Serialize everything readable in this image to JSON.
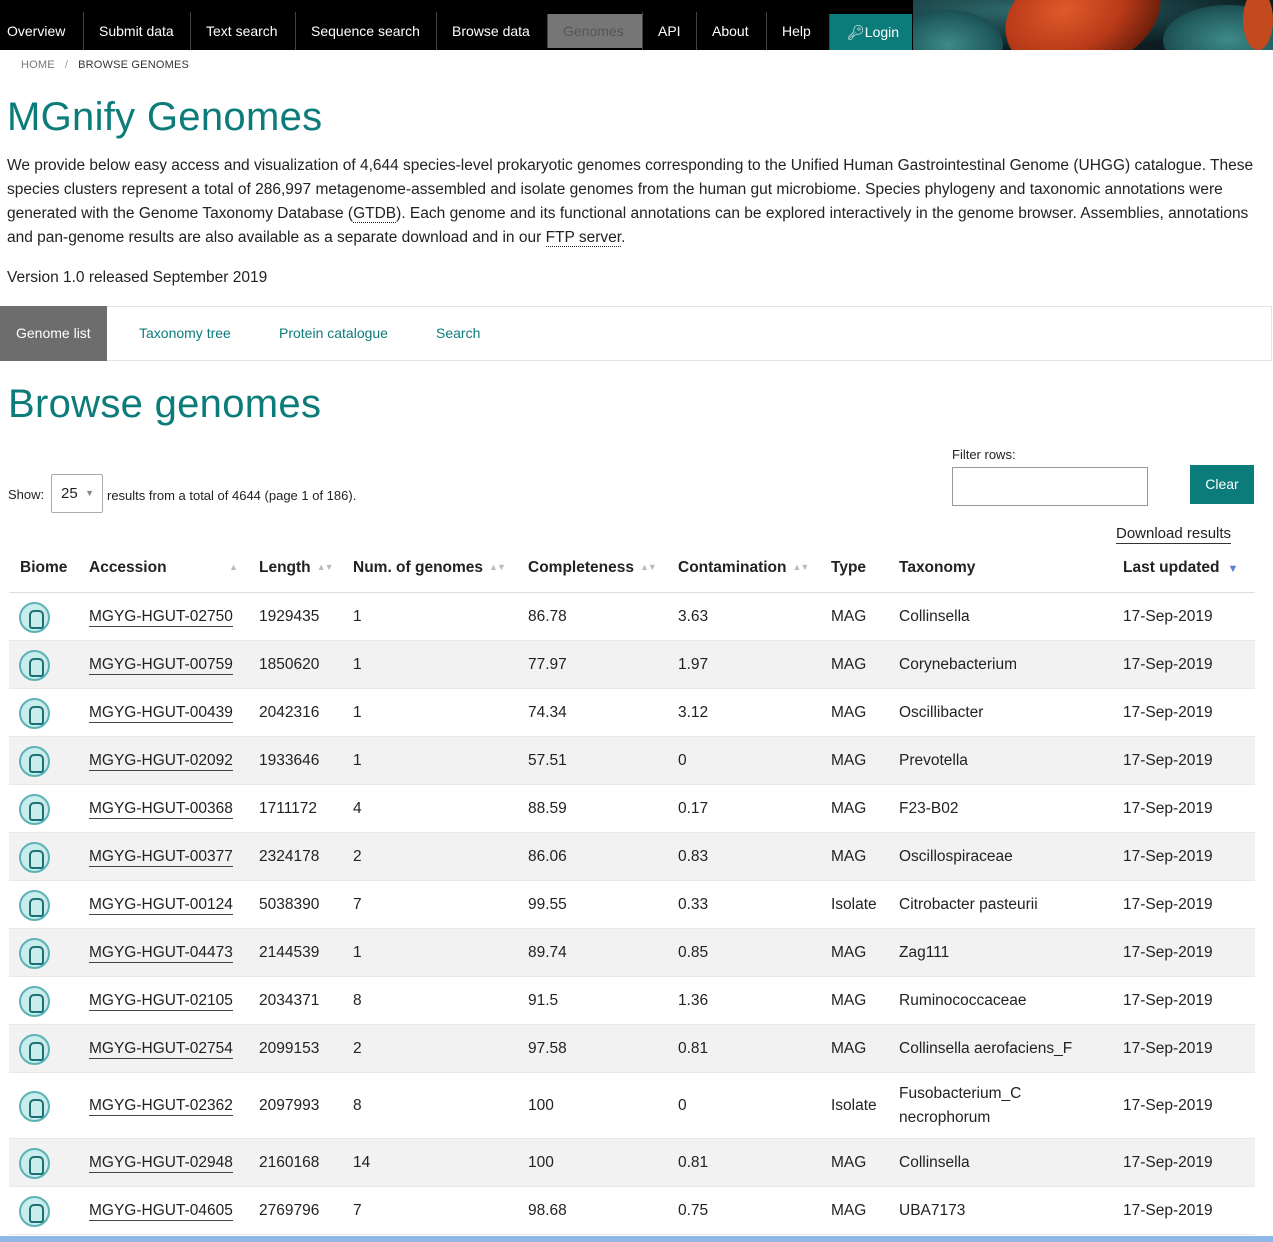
{
  "nav": {
    "items": [
      "Overview",
      "Submit data",
      "Text search",
      "Sequence search",
      "Browse data",
      "Genomes",
      "API",
      "About",
      "Help"
    ],
    "active": "Genomes",
    "login_label": "Login",
    "login_icon": "key-icon",
    "colors": {
      "bar": "#000000",
      "active_tab": "#767676",
      "login": "#0b7c79"
    }
  },
  "breadcrumb": {
    "home": "HOME",
    "current": "BROWSE GENOMES"
  },
  "page": {
    "title": "MGnify Genomes",
    "intro_1": "We provide below easy access and visualization of 4,644 species-level prokaryotic genomes corresponding to the Unified Human Gastrointestinal Genome (UHGG) catalogue. These species clusters represent a total of 286,997 metagenome-assembled and isolate genomes from the human gut microbiome. Species phylogeny and taxonomic annotations were generated with the Genome Taxonomy Database (",
    "intro_gtdb": "GTDB",
    "intro_2": "). Each genome and its functional annotations can be explored interactively in the genome browser. Assemblies, annotations and pan-genome results are also available as a separate download and in our ",
    "intro_ftp": "FTP server",
    "intro_3": ".",
    "version": "Version 1.0 released September 2019"
  },
  "tabs": [
    "Genome list",
    "Taxonomy tree",
    "Protein catalogue",
    "Search"
  ],
  "browse": {
    "title": "Browse genomes",
    "show_label": "Show:",
    "page_size": "25",
    "results_text": "results from a total of 4644 (page 1 of 186).",
    "filter_label": "Filter rows:",
    "clear_label": "Clear",
    "download_label": "Download results"
  },
  "table": {
    "columns": [
      "Biome",
      "Accession",
      "Length",
      "Num. of genomes",
      "Completeness",
      "Contamination",
      "Type",
      "Taxonomy",
      "Last updated"
    ],
    "sort_column": "Last updated",
    "biome_icon": "human-gut-biome-icon",
    "rows": [
      {
        "accession": "MGYG-HGUT-02750",
        "length": "1929435",
        "num": "1",
        "completeness": "86.78",
        "contamination": "3.63",
        "type": "MAG",
        "taxonomy": "Collinsella",
        "updated": "17-Sep-2019"
      },
      {
        "accession": "MGYG-HGUT-00759",
        "length": "1850620",
        "num": "1",
        "completeness": "77.97",
        "contamination": "1.97",
        "type": "MAG",
        "taxonomy": "Corynebacterium",
        "updated": "17-Sep-2019"
      },
      {
        "accession": "MGYG-HGUT-00439",
        "length": "2042316",
        "num": "1",
        "completeness": "74.34",
        "contamination": "3.12",
        "type": "MAG",
        "taxonomy": "Oscillibacter",
        "updated": "17-Sep-2019"
      },
      {
        "accession": "MGYG-HGUT-02092",
        "length": "1933646",
        "num": "1",
        "completeness": "57.51",
        "contamination": "0",
        "type": "MAG",
        "taxonomy": "Prevotella",
        "updated": "17-Sep-2019"
      },
      {
        "accession": "MGYG-HGUT-00368",
        "length": "1711172",
        "num": "4",
        "completeness": "88.59",
        "contamination": "0.17",
        "type": "MAG",
        "taxonomy": "F23-B02",
        "updated": "17-Sep-2019"
      },
      {
        "accession": "MGYG-HGUT-00377",
        "length": "2324178",
        "num": "2",
        "completeness": "86.06",
        "contamination": "0.83",
        "type": "MAG",
        "taxonomy": "Oscillospiraceae",
        "updated": "17-Sep-2019"
      },
      {
        "accession": "MGYG-HGUT-00124",
        "length": "5038390",
        "num": "7",
        "completeness": "99.55",
        "contamination": "0.33",
        "type": "Isolate",
        "taxonomy": "Citrobacter pasteurii",
        "updated": "17-Sep-2019"
      },
      {
        "accession": "MGYG-HGUT-04473",
        "length": "2144539",
        "num": "1",
        "completeness": "89.74",
        "contamination": "0.85",
        "type": "MAG",
        "taxonomy": "Zag111",
        "updated": "17-Sep-2019"
      },
      {
        "accession": "MGYG-HGUT-02105",
        "length": "2034371",
        "num": "8",
        "completeness": "91.5",
        "contamination": "1.36",
        "type": "MAG",
        "taxonomy": "Ruminococcaceae",
        "updated": "17-Sep-2019"
      },
      {
        "accession": "MGYG-HGUT-02754",
        "length": "2099153",
        "num": "2",
        "completeness": "97.58",
        "contamination": "0.81",
        "type": "MAG",
        "taxonomy": "Collinsella aerofaciens_F",
        "updated": "17-Sep-2019"
      },
      {
        "accession": "MGYG-HGUT-02362",
        "length": "2097993",
        "num": "8",
        "completeness": "100",
        "contamination": "0",
        "type": "Isolate",
        "taxonomy": "Fusobacterium_C necrophorum",
        "updated": "17-Sep-2019"
      },
      {
        "accession": "MGYG-HGUT-02948",
        "length": "2160168",
        "num": "14",
        "completeness": "100",
        "contamination": "0.81",
        "type": "MAG",
        "taxonomy": "Collinsella",
        "updated": "17-Sep-2019"
      },
      {
        "accession": "MGYG-HGUT-04605",
        "length": "2769796",
        "num": "7",
        "completeness": "98.68",
        "contamination": "0.75",
        "type": "MAG",
        "taxonomy": "UBA7173",
        "updated": "17-Sep-2019"
      }
    ]
  }
}
